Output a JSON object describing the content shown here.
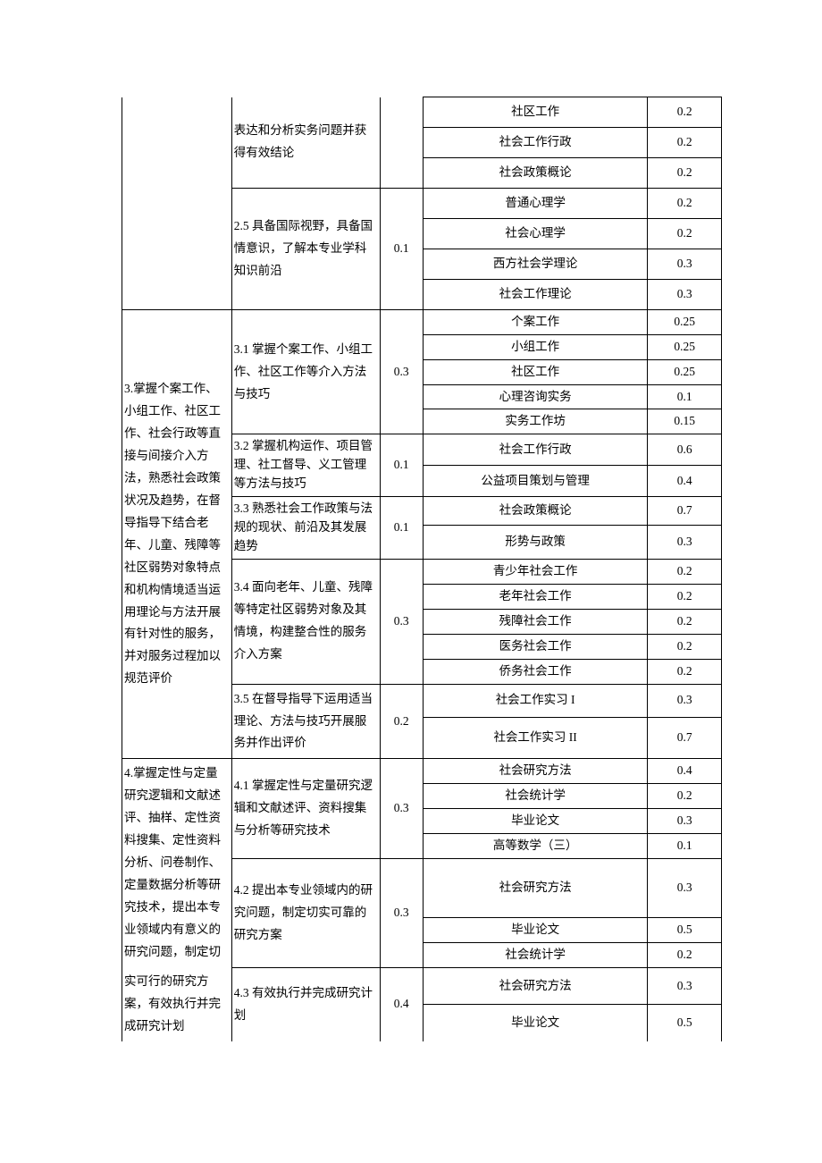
{
  "r": {
    "g2_cont": {
      "sub24_cont": "表达和分析实务问题并获得有效结论",
      "c4": [
        "社区工作",
        "社会工作行政",
        "社会政策概论"
      ],
      "c5": [
        "0.2",
        "0.2",
        "0.2"
      ],
      "sub25": "2.5 具备国际视野，具备国情意识，了解本专业学科知识前沿",
      "w25": "0.1",
      "c4b": [
        "普通心理学",
        "社会心理学",
        "西方社会学理论",
        "社会工作理论"
      ],
      "c5b": [
        "0.2",
        "0.2",
        "0.3",
        "0.3"
      ]
    },
    "g3": {
      "title": "3.掌握个案工作、小组工作、社区工作、社会行政等直接与间接介入方法，熟悉社会政策状况及趋势，在督导指导下结合老年、儿童、残障等社区弱势对象特点和机构情境适当运用理论与方法开展有针对性的服务，并对服务过程加以规范评价",
      "sub31": "3.1 掌握个案工作、小组工作、社区工作等介入方法与技巧",
      "w31": "0.3",
      "c31_4": [
        "个案工作",
        "小组工作",
        "社区工作",
        "心理咨询实务",
        "实务工作坊"
      ],
      "c31_5": [
        "0.25",
        "0.25",
        "0.25",
        "0.1",
        "0.15"
      ],
      "sub32": "3.2 掌握机构运作、项目管理、社工督导、义工管理等方法与技巧",
      "w32": "0.1",
      "c32_4": [
        "社会工作行政",
        "公益项目策划与管理"
      ],
      "c32_5": [
        "0.6",
        "0.4"
      ],
      "sub33": "3.3 熟悉社会工作政策与法规的现状、前沿及其发展趋势",
      "w33": "0.1",
      "c33_4": [
        "社会政策概论",
        "形势与政策"
      ],
      "c33_5": [
        "0.7",
        "0.3"
      ],
      "sub34": "3.4 面向老年、儿童、残障等特定社区弱势对象及其情境，构建整合性的服务介入方案",
      "w34": "0.3",
      "c34_4": [
        "青少年社会工作",
        "老年社会工作",
        "残障社会工作",
        "医务社会工作",
        "侨务社会工作"
      ],
      "c34_5": [
        "0.2",
        "0.2",
        "0.2",
        "0.2",
        "0.2"
      ],
      "sub35": "3.5 在督导指导下运用适当理论、方法与技巧开展服务并作出评价",
      "w35": "0.2",
      "c35_4": [
        "社会工作实习 I",
        "社会工作实习 II"
      ],
      "c35_5": [
        "0.3",
        "0.7"
      ]
    },
    "g4": {
      "titleA": "4.掌握定性与定量研究逻辑和文献述评、抽样、定性资料搜集、定性资料分析、问卷制作、定量数据分析等研究技术，提出本专业领域内有意义的研究问题，制定切",
      "titleB": "实可行的研究方案，有效执行并完成研究计划",
      "sub41": "4.1 掌握定性与定量研究逻辑和文献述评、资料搜集与分析等研究技术",
      "w41": "0.3",
      "c41_4": [
        "社会研究方法",
        "社会统计学",
        "毕业论文",
        "高等数学（三）"
      ],
      "c41_5": [
        "0.4",
        "0.2",
        "0.3",
        "0.1"
      ],
      "sub42": "4.2 提出本专业领域内的研究问题，制定切实可靠的研究方案",
      "w42": "0.3",
      "c42_4": [
        "社会研究方法",
        "毕业论文",
        "社会统计学"
      ],
      "c42_5": [
        "0.3",
        "0.5",
        "0.2"
      ],
      "sub43": "4.3 有效执行并完成研究计划",
      "w43": "0.4",
      "c43_4": [
        "社会研究方法",
        "毕业论文"
      ],
      "c43_5": [
        "0.3",
        "0.5"
      ]
    }
  }
}
